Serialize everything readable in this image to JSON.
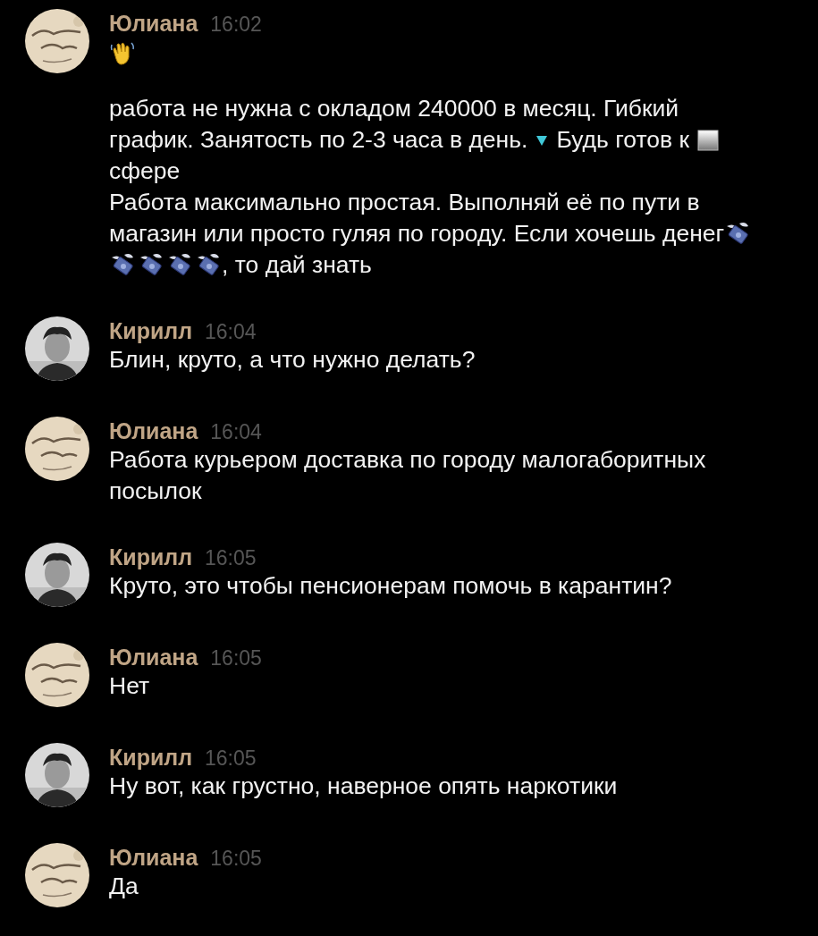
{
  "messages": [
    {
      "author": "Юлиана",
      "time": "16:02",
      "avatar": {
        "kind": "picture"
      },
      "paragraphs": [
        [
          [
            {
              "kind": "wave-emoji"
            }
          ]
        ],
        [
          [
            {
              "kind": "text",
              "text": "работа не нужна с окладом 240000 в месяц. Гибкий"
            }
          ],
          [
            {
              "kind": "text",
              "text": "график. Занятость по 2-3 часа в день."
            },
            {
              "kind": "triangle-emoji"
            },
            {
              "kind": "text",
              "text": "Будь готов к"
            },
            {
              "kind": "square-emoji"
            }
          ],
          [
            {
              "kind": "text",
              "text": "сфере"
            }
          ],
          [
            {
              "kind": "text",
              "text": "Работа максимально простая. Выполняй её по пути в"
            }
          ],
          [
            {
              "kind": "text",
              "text": "магазин или просто гуляя по городу. Если хочешь денег"
            },
            {
              "kind": "money-emoji"
            }
          ],
          [
            {
              "kind": "money-emoji"
            },
            {
              "kind": "money-emoji"
            },
            {
              "kind": "money-emoji"
            },
            {
              "kind": "money-emoji"
            },
            {
              "kind": "text",
              "text": ", то дай знать"
            }
          ]
        ]
      ]
    },
    {
      "author": "Кирилл",
      "time": "16:04",
      "avatar": {
        "kind": "picture"
      },
      "paragraphs": [
        [
          [
            {
              "kind": "text",
              "text": "Блин, круто, а что нужно делать?"
            }
          ]
        ]
      ]
    },
    {
      "author": "Юлиана",
      "time": "16:04",
      "avatar": {
        "kind": "picture"
      },
      "paragraphs": [
        [
          [
            {
              "kind": "text",
              "text": "Работа курьером доставка по городу малогаборитных"
            }
          ],
          [
            {
              "kind": "text",
              "text": "посылок"
            }
          ]
        ]
      ]
    },
    {
      "author": "Кирилл",
      "time": "16:05",
      "avatar": {
        "kind": "picture"
      },
      "paragraphs": [
        [
          [
            {
              "kind": "text",
              "text": "Круто, это чтобы пенсионерам помочь в карантин?"
            }
          ]
        ]
      ]
    },
    {
      "author": "Юлиана",
      "time": "16:05",
      "avatar": {
        "kind": "picture"
      },
      "paragraphs": [
        [
          [
            {
              "kind": "text",
              "text": "Нет"
            }
          ]
        ]
      ]
    },
    {
      "author": "Кирилл",
      "time": "16:05",
      "avatar": {
        "kind": "picture"
      },
      "paragraphs": [
        [
          [
            {
              "kind": "text",
              "text": "Ну вот, как грустно, наверное опять наркотики"
            }
          ]
        ]
      ]
    },
    {
      "author": "Юлиана",
      "time": "16:05",
      "avatar": {
        "kind": "picture"
      },
      "paragraphs": [
        [
          [
            {
              "kind": "text",
              "text": "Да"
            }
          ]
        ]
      ]
    }
  ]
}
